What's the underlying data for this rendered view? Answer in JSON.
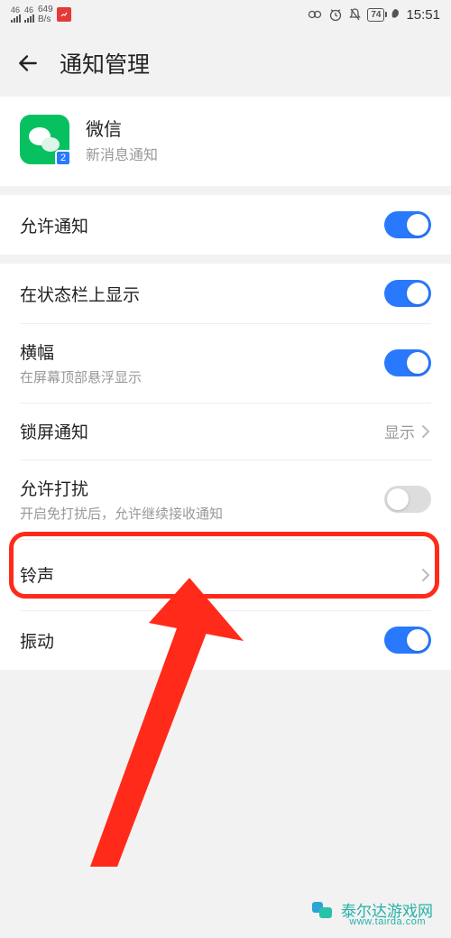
{
  "status": {
    "net_label": "46",
    "speed_value": "649",
    "speed_unit": "B/s",
    "battery": "74",
    "time": "15:51"
  },
  "header": {
    "title": "通知管理"
  },
  "app": {
    "name": "微信",
    "subtitle": "新消息通知",
    "badge": "2"
  },
  "rows": {
    "allow_notify": "允许通知",
    "show_status_bar": "在状态栏上显示",
    "banner": "横幅",
    "banner_sub": "在屏幕顶部悬浮显示",
    "lockscreen": "锁屏通知",
    "lockscreen_value": "显示",
    "allow_disturb": "允许打扰",
    "allow_disturb_sub": "开启免打扰后，允许继续接收通知",
    "ringtone": "铃声",
    "vibration": "振动"
  },
  "watermark": {
    "name": "泰尔达游戏网",
    "url": "www.tairda.com"
  }
}
